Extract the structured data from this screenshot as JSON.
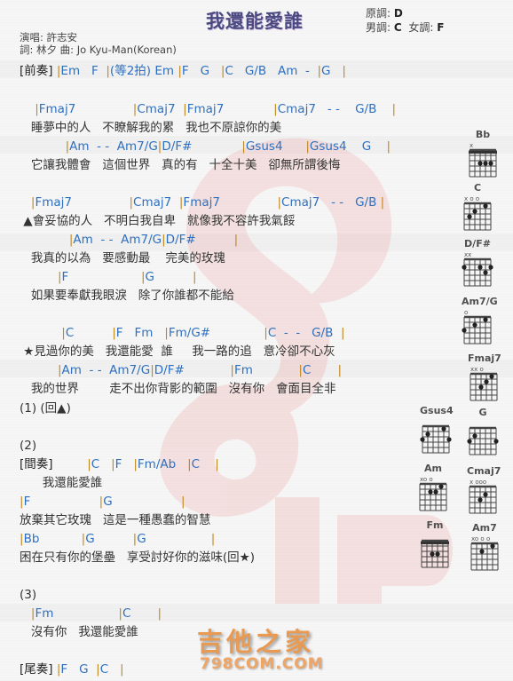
{
  "song": {
    "title": "我還能愛誰",
    "original_key_label": "原調:",
    "original_key": "D",
    "male_key_label": "男調:",
    "male_key": "C",
    "female_key_label": "女調:",
    "female_key": "F",
    "singer_line": "演唱: 許志安",
    "credits_line": "詞: 林夕   曲: Jo Kyu-Man(Korean)"
  },
  "sheet": {
    "prelude": {
      "tag": "[前奏]",
      "chords": " |Em   F  |(等2拍) Em |F   G   |C   G/B   Am  -  |G   |"
    },
    "v1_c1": "    |Fmaj7               |Cmaj7  |Fmaj7             |Cmaj7   - -    G/B    |",
    "v1_l1": "   睡夢中的人   不瞭解我的累   我也不原諒你的美",
    "v1_c2": "            |Am  - -  Am7/G|D/F#             |Gsus4      |Gsus4    G    |",
    "v1_l2": "   它讓我體會   這個世界   真的有   十全十美   卻無所謂後悔",
    "v2_c1": "   |Fmaj7               |Cmaj7  |Fmaj7               |Cmaj7   - -   G/B |",
    "v2_l1": " ▲會妥協的人   不明白我自卑   就像我不容許我氣餒",
    "v2_c2": "             |Am  - -  Am7/G|D/F#          |",
    "v2_l2": "   我真的以為   要感動最    完美的玫瑰",
    "v2_c3": "          |F                   |G          |",
    "v2_l3": "   如果要奉獻我眼淚   除了你誰都不能給",
    "ch_c1": "           |C          |F   Fm   |Fm/G#              |C  -  -   G/B  |",
    "ch_l1": " ★見過你的美   我還能愛  誰     我一路的追   意冷卻不心灰",
    "ch_c2": "          |Am  - -  Am7/G|D/F#            |Fm            |C       |",
    "ch_l2": "   我的世界        走不出你背影的範圍   沒有你   會面目全非",
    "mark1": "(1) (回▲)",
    "mark2": "(2)",
    "interlude": {
      "tag": "[間奏]",
      "chords": "         |C   |F   |Fm/Ab   |C    |"
    },
    "i_l1": "      我還能愛誰",
    "b_c1": "|F                  |G                  |",
    "b_l1": "放棄其它玫瑰   這是一種愚蠢的智慧",
    "b_c2": "|Bb           |G          |G                 |",
    "b_l2": "困在只有你的堡壘   享受討好你的滋味(回★)",
    "mark3": "(3)",
    "e_c1": "   |Fm                 |C       |",
    "e_l1": "   沒有你   我還能愛誰",
    "outro": {
      "tag": "[尾奏]",
      "chords": " |F   G  |C   |"
    }
  },
  "chord_charts": [
    {
      "name": "Bb"
    },
    {
      "name": "C"
    },
    {
      "name": "D/F#"
    },
    {
      "name": "Am7/G"
    },
    {
      "name": "Fmaj7"
    },
    {
      "name": "Gsus4"
    },
    {
      "name": "G"
    },
    {
      "name": "Am"
    },
    {
      "name": "Cmaj7"
    },
    {
      "name": "Fm"
    },
    {
      "name": "Am7"
    }
  ],
  "watermark": {
    "cn": "吉他之家",
    "url": "798COM.COM"
  },
  "colors": {
    "chord": "#2e70c0",
    "bar": "#c08820",
    "title": "#4a4a80",
    "watermark_orange": "#e99a52",
    "logo_red": "#e94a4a"
  }
}
